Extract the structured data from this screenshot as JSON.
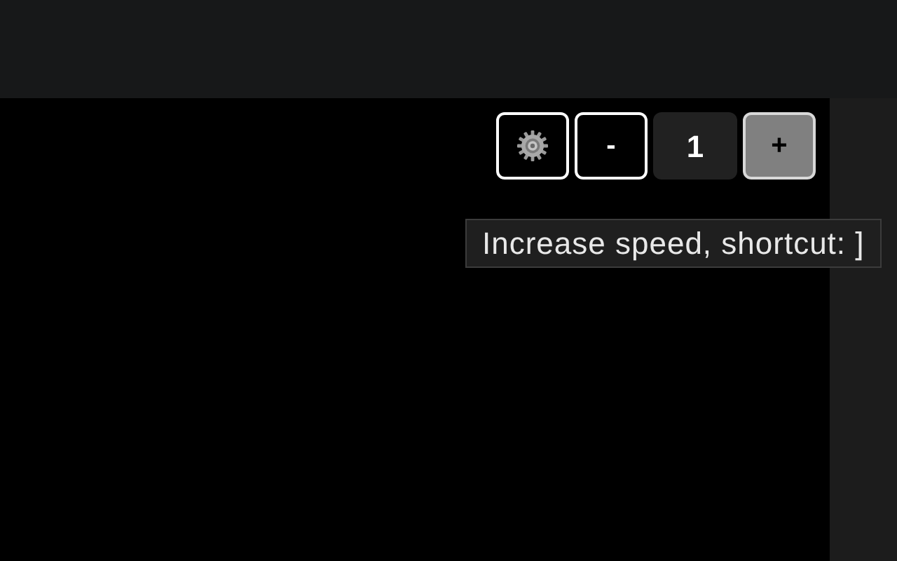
{
  "speed_controls": [
    {
      "kind": "settings",
      "hovered": false
    },
    {
      "kind": "button",
      "label": "-",
      "hovered": false
    },
    {
      "kind": "value",
      "label": "1"
    },
    {
      "kind": "button",
      "label": "+",
      "hovered": true
    }
  ],
  "tooltip": {
    "text": "Increase speed, shortcut: ]"
  }
}
